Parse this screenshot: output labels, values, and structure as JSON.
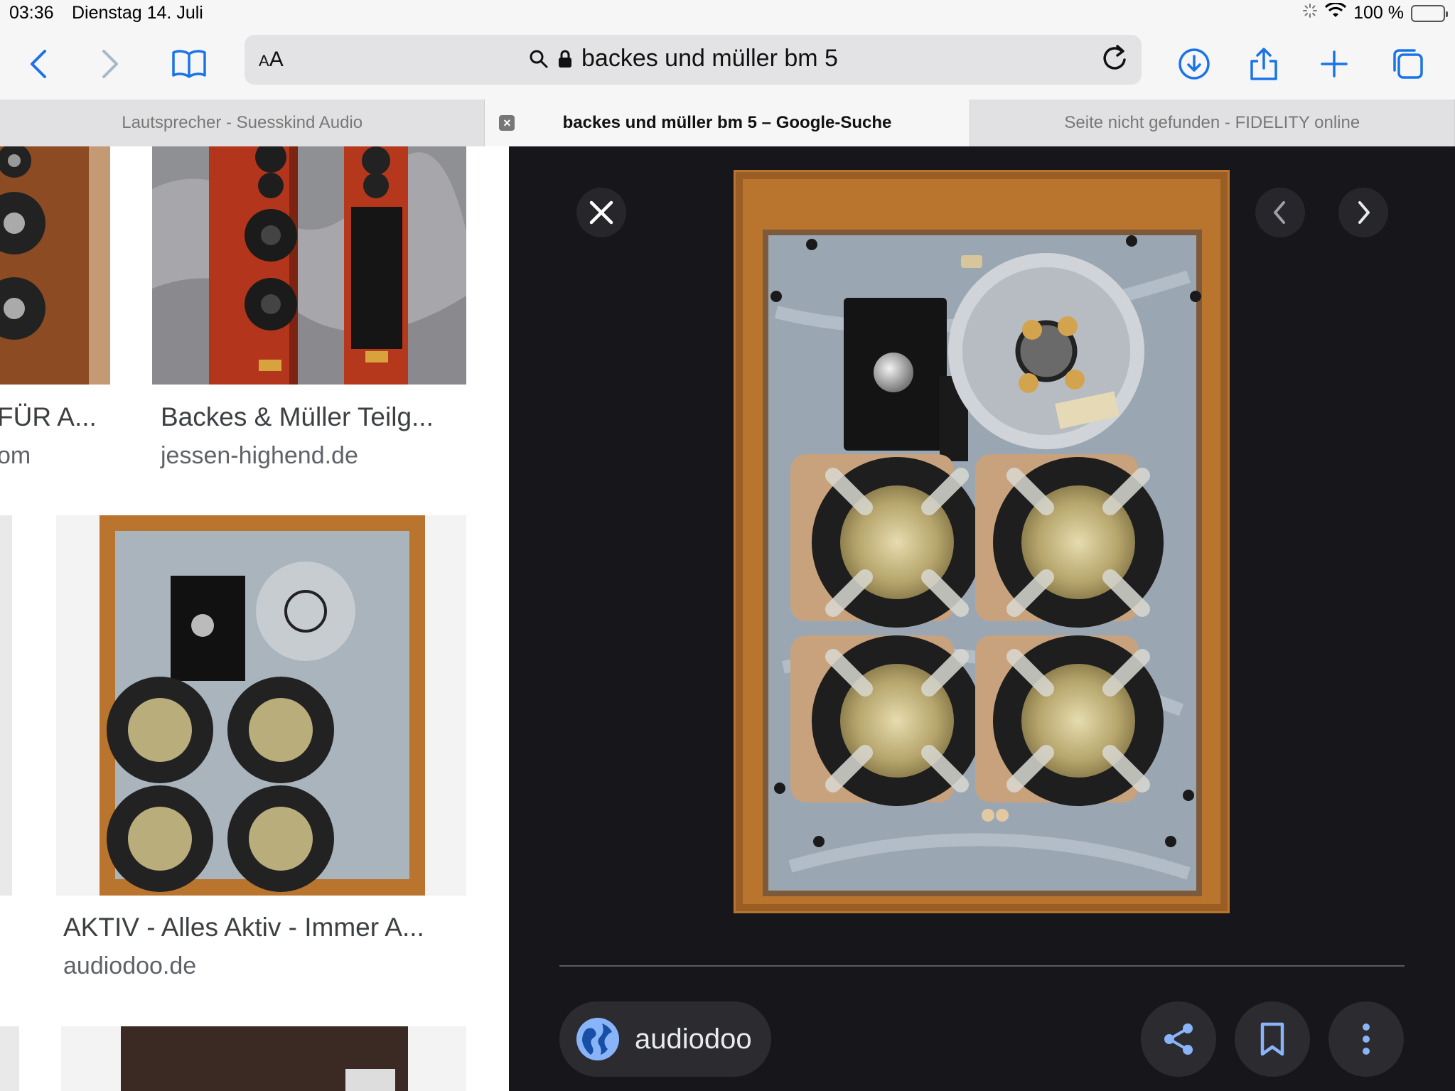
{
  "status_bar": {
    "time": "03:36",
    "date": "Dienstag 14. Juli",
    "battery": "100 %",
    "battery_level": 1.0
  },
  "toolbar": {
    "reader_label": "AA",
    "url_text": "backes und müller bm 5",
    "icons": [
      "back-icon",
      "forward-icon",
      "bookmarks-icon",
      "search-icon",
      "lock-icon",
      "reload-icon",
      "download-icon",
      "share-icon",
      "plus-icon",
      "tabs-icon"
    ]
  },
  "tabs": [
    {
      "label": "Lautsprecher - Suesskind Audio"
    },
    {
      "label": "backes und müller bm 5 – Google-Suche"
    },
    {
      "label": "Seite nicht gefunden - FIDELITY online"
    }
  ],
  "results": [
    {
      "title": "FÜR A...",
      "source": "om"
    },
    {
      "title": "Backes & Müller Teilg...",
      "source": "jessen-highend.de"
    },
    {
      "title": "AKTIV - Alles Aktiv - Immer A...",
      "source": "audiodoo.de"
    }
  ],
  "viewer": {
    "source_name": "audiodoo",
    "colors": {
      "background": "#17171b",
      "accent": "#8ab4f8",
      "wood": "#b9742e"
    }
  }
}
